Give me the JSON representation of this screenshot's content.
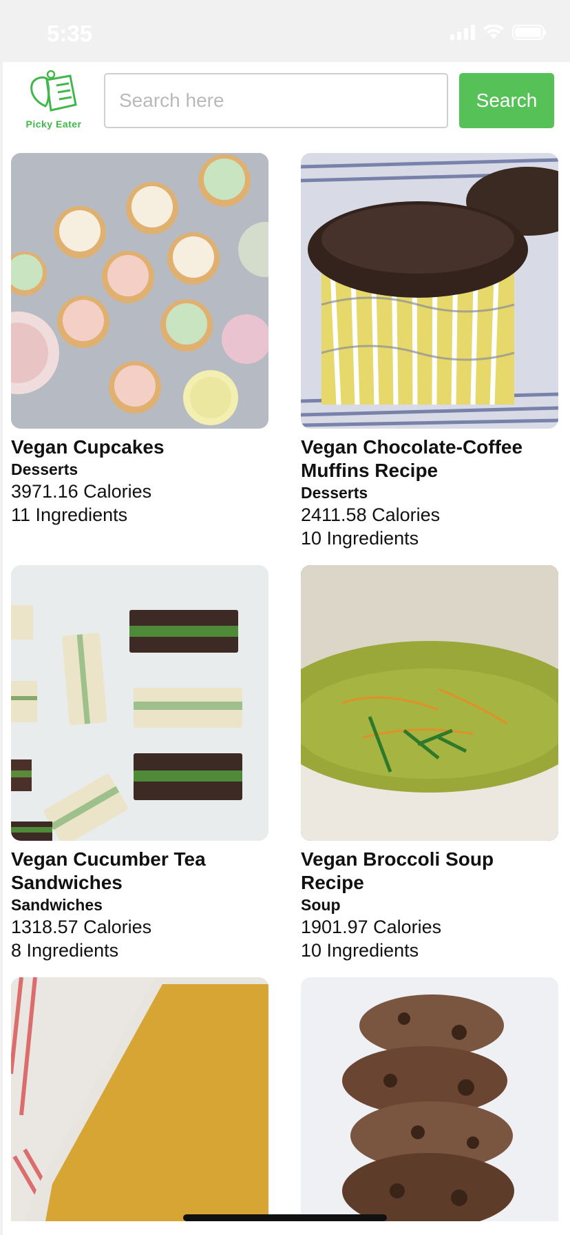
{
  "status": {
    "time": "5:35"
  },
  "app": {
    "name": "Picky Eater"
  },
  "search": {
    "placeholder": "Search here",
    "button_label": "Search"
  },
  "recipes": [
    {
      "title": "Vegan Cupcakes",
      "category": "Desserts",
      "calories": "3971.16 Calories",
      "ingredients": "11 Ingredients"
    },
    {
      "title": "Vegan Chocolate-Coffee Muffins Recipe",
      "category": "Desserts",
      "calories": "2411.58 Calories",
      "ingredients": "10 Ingredients"
    },
    {
      "title": "Vegan Cucumber Tea Sandwiches",
      "category": "Sandwiches",
      "calories": "1318.57 Calories",
      "ingredients": "8 Ingredients"
    },
    {
      "title": "Vegan Broccoli Soup Recipe",
      "category": "Soup",
      "calories": "1901.97 Calories",
      "ingredients": "10 Ingredients"
    }
  ],
  "colors": {
    "accent": "#55c157",
    "brand": "#3fb84a"
  }
}
